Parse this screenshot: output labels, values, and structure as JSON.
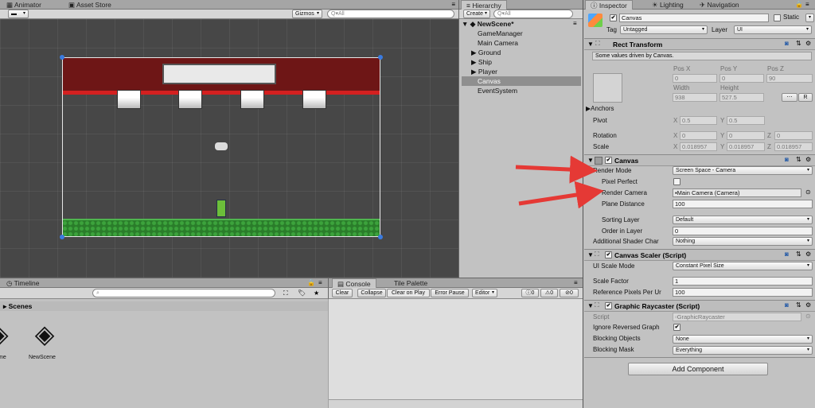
{
  "scene_view": {
    "tabs": [
      {
        "label": "Animator"
      },
      {
        "label": "Asset Store"
      }
    ],
    "toolbar": {
      "gizmos_label": "Gizmos",
      "search_placeholder": "Q▾All"
    }
  },
  "hierarchy": {
    "tab_label": "Hierarchy",
    "create_label": "Create",
    "search_placeholder": "Q▾All",
    "scene_name": "NewScene*",
    "items": [
      {
        "label": "GameManager"
      },
      {
        "label": "Main Camera"
      },
      {
        "label": "Ground"
      },
      {
        "label": "Ship"
      },
      {
        "label": "Player"
      },
      {
        "label": "Canvas"
      },
      {
        "label": "EventSystem"
      }
    ]
  },
  "timeline": {
    "tab_label": "Timeline",
    "folder_label": "Scenes",
    "assets": [
      {
        "label": "me"
      },
      {
        "label": "NewScene"
      }
    ]
  },
  "console": {
    "tabs": [
      {
        "label": "Console"
      },
      {
        "label": "Tile Palette"
      }
    ],
    "buttons": {
      "clear": "Clear",
      "collapse": "Collapse",
      "clear_on_play": "Clear on Play",
      "error_pause": "Error Pause",
      "editor": "Editor"
    },
    "counts": {
      "info": "0",
      "warn": "0",
      "error": "0"
    }
  },
  "inspector": {
    "tabs": [
      {
        "label": "Inspector"
      },
      {
        "label": "Lighting"
      },
      {
        "label": "Navigation"
      }
    ],
    "object_name": "Canvas",
    "static_label": "Static",
    "tag_label": "Tag",
    "tag_value": "Untagged",
    "layer_label": "Layer",
    "layer_value": "UI",
    "rect_transform": {
      "title": "Rect Transform",
      "note": "Some values driven by Canvas.",
      "posx_label": "Pos X",
      "posy_label": "Pos Y",
      "posz_label": "Pos Z",
      "posx": "0",
      "posy": "0",
      "posz": "90",
      "width_label": "Width",
      "height_label": "Height",
      "width": "938",
      "height": "527.5",
      "r_label": "R",
      "anchors_label": "Anchors",
      "pivot_label": "Pivot",
      "pivot_x": "0.5",
      "pivot_y": "0.5",
      "rotation_label": "Rotation",
      "rot_x": "0",
      "rot_y": "0",
      "rot_z": "0",
      "scale_label": "Scale",
      "scale_x": "0.018957",
      "scale_y": "0.018957",
      "scale_z": "0.018957",
      "x": "X",
      "y": "Y",
      "z": "Z"
    },
    "canvas": {
      "title": "Canvas",
      "render_mode_label": "Render Mode",
      "render_mode": "Screen Space - Camera",
      "pixel_perfect_label": "Pixel Perfect",
      "render_camera_label": "Render Camera",
      "render_camera": "Main Camera (Camera)",
      "plane_distance_label": "Plane Distance",
      "plane_distance": "100",
      "sorting_layer_label": "Sorting Layer",
      "sorting_layer": "Default",
      "order_label": "Order in Layer",
      "order": "0",
      "shader_label": "Additional Shader Char",
      "shader": "Nothing"
    },
    "scaler": {
      "title": "Canvas Scaler (Script)",
      "mode_label": "UI Scale Mode",
      "mode": "Constant Pixel Size",
      "factor_label": "Scale Factor",
      "factor": "1",
      "ref_label": "Reference Pixels Per Ur",
      "ref": "100"
    },
    "raycaster": {
      "title": "Graphic Raycaster (Script)",
      "script_label": "Script",
      "script": "GraphicRaycaster",
      "ignore_label": "Ignore Reversed Graph",
      "blocking_objects_label": "Blocking Objects",
      "blocking_objects": "None",
      "blocking_mask_label": "Blocking Mask",
      "blocking_mask": "Everything"
    },
    "add_component": "Add Component"
  },
  "colors": {
    "annotation_arrow": "#e53935",
    "scene_bg": "#474747",
    "banner_red": "#7a1a1a",
    "ground_green": "#2f8a2f"
  }
}
